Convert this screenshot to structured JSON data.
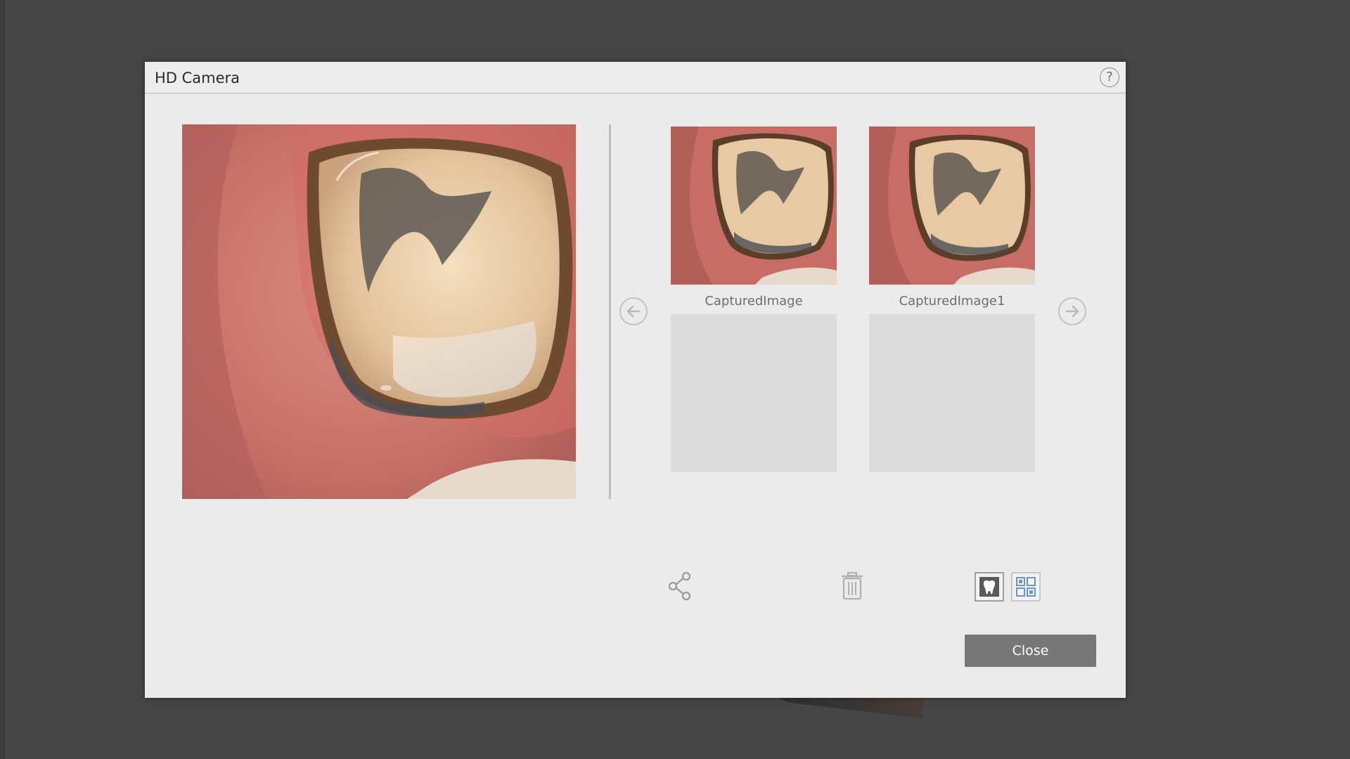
{
  "dialog": {
    "title": "HD Camera",
    "help_label": "?"
  },
  "captures": [
    {
      "label": "CapturedImage"
    },
    {
      "label": "CapturedImage1"
    }
  ],
  "icons": {
    "help": "question-mark-icon",
    "prev": "arrow-left-icon",
    "next": "arrow-right-icon",
    "share": "share-icon",
    "trash": "trash-icon",
    "tooth_view": "tooth-icon",
    "grid_view": "grid-icon"
  },
  "footer": {
    "close_label": "Close"
  },
  "colors": {
    "backdrop": "#454545",
    "dialog_bg": "#ebebeb",
    "close_button": "#777777",
    "grid_icon_accent": "#6f93c7"
  }
}
